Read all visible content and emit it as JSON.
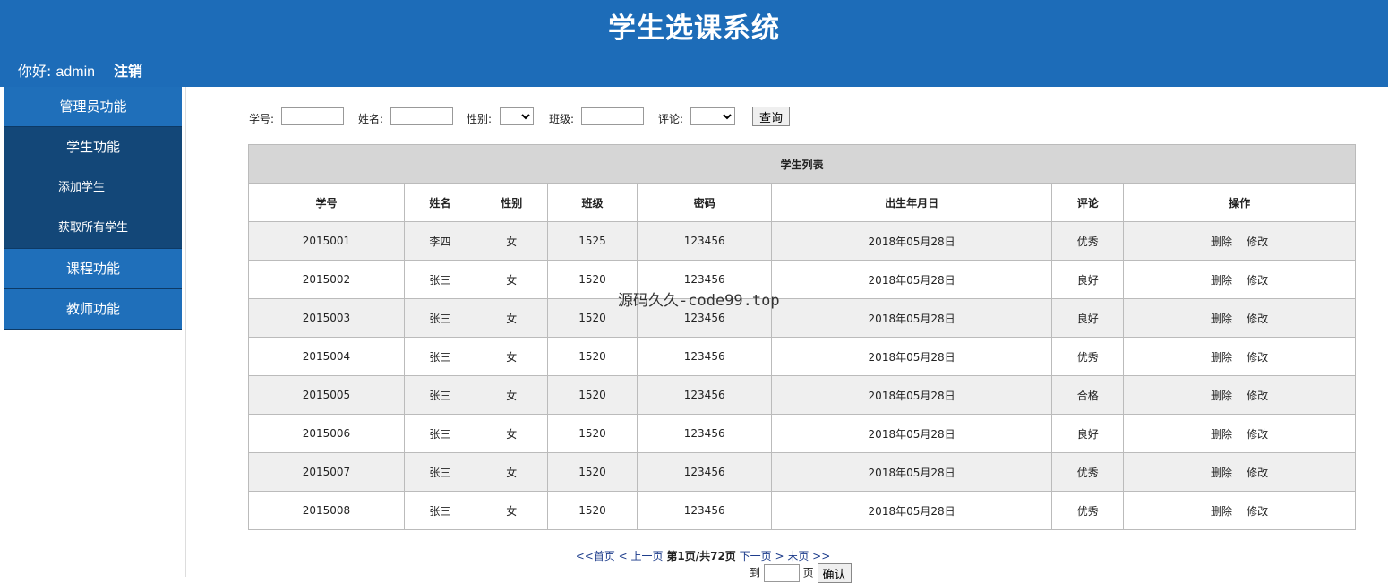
{
  "app_title": "学生选课系统",
  "header": {
    "greeting_prefix": "你好:",
    "username": "admin",
    "logout_label": "注销"
  },
  "sidebar": {
    "admin": "管理员功能",
    "student": "学生功能",
    "student_sub": [
      "添加学生",
      "获取所有学生"
    ],
    "course": "课程功能",
    "teacher": "教师功能"
  },
  "search": {
    "id_label": "学号:",
    "id_value": "",
    "name_label": "姓名:",
    "name_value": "",
    "gender_label": "性别:",
    "gender_value": "",
    "class_label": "班级:",
    "class_value": "",
    "comment_label": "评论:",
    "comment_value": "",
    "query_button": "查询"
  },
  "table": {
    "caption": "学生列表",
    "columns": [
      "学号",
      "姓名",
      "性别",
      "班级",
      "密码",
      "出生年月日",
      "评论",
      "操作"
    ],
    "rows": [
      [
        "2015001",
        "李四",
        "女",
        "1525",
        "123456",
        "2018年05月28日",
        "优秀"
      ],
      [
        "2015002",
        "张三",
        "女",
        "1520",
        "123456",
        "2018年05月28日",
        "良好"
      ],
      [
        "2015003",
        "张三",
        "女",
        "1520",
        "123456",
        "2018年05月28日",
        "良好"
      ],
      [
        "2015004",
        "张三",
        "女",
        "1520",
        "123456",
        "2018年05月28日",
        "优秀"
      ],
      [
        "2015005",
        "张三",
        "女",
        "1520",
        "123456",
        "2018年05月28日",
        "合格"
      ],
      [
        "2015006",
        "张三",
        "女",
        "1520",
        "123456",
        "2018年05月28日",
        "良好"
      ],
      [
        "2015007",
        "张三",
        "女",
        "1520",
        "123456",
        "2018年05月28日",
        "优秀"
      ],
      [
        "2015008",
        "张三",
        "女",
        "1520",
        "123456",
        "2018年05月28日",
        "优秀"
      ]
    ],
    "actions": {
      "delete": "删除",
      "edit": "修改"
    }
  },
  "watermark": "源码久久-code99.top",
  "pager": {
    "first": "<<首页",
    "prev": "< 上一页",
    "status": "第1页/共72页",
    "next": "下一页 >",
    "last": "末页 >>",
    "jump_prefix": "到",
    "jump_value": "",
    "jump_suffix": "页",
    "confirm": "确认"
  }
}
